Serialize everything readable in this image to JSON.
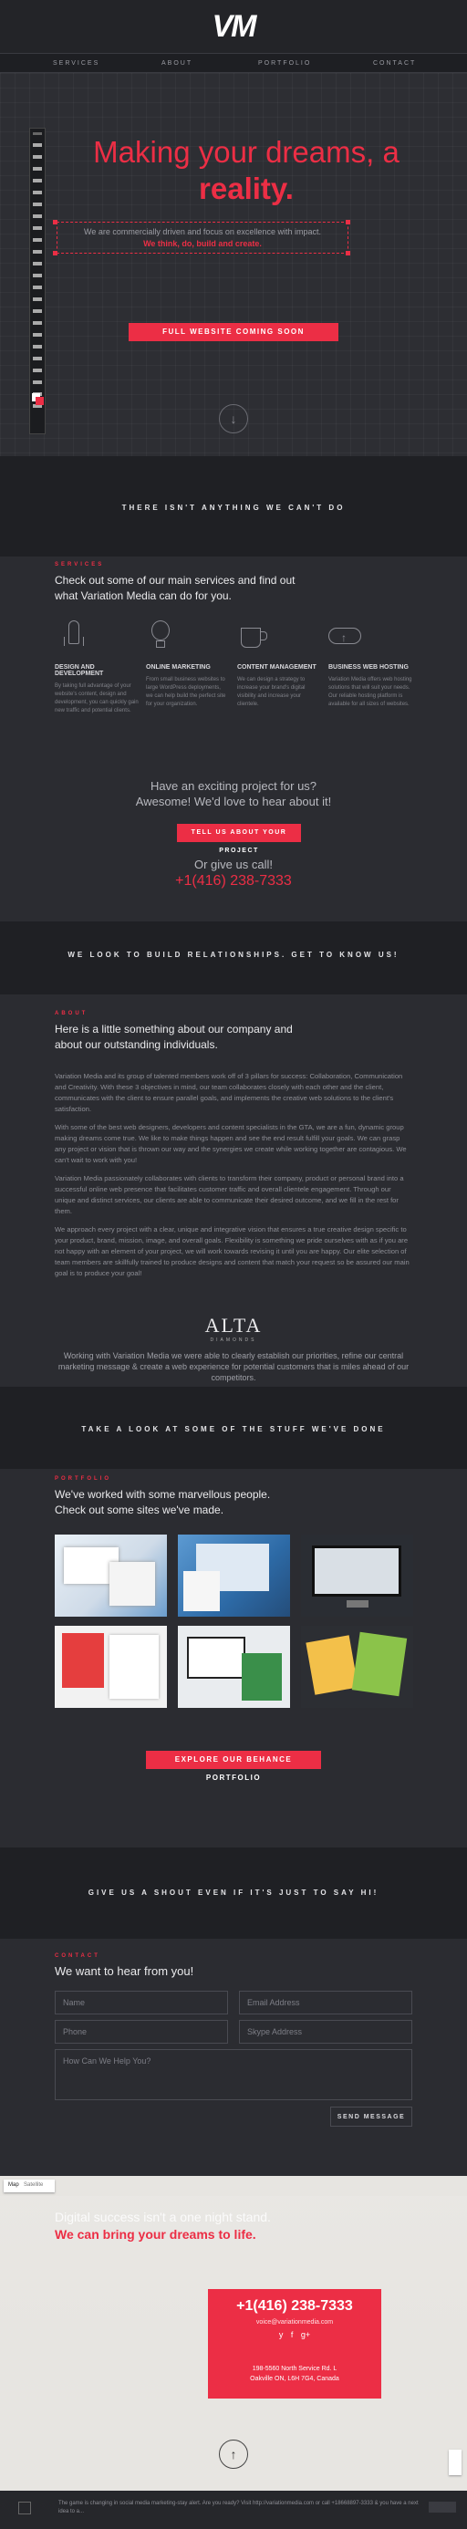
{
  "header": {
    "logo": "VM",
    "nav": [
      "SERVICES",
      "ABOUT",
      "PORTFOLIO",
      "CONTACT"
    ]
  },
  "hero": {
    "title_line1": "Making your dreams, a",
    "title_line2": "reality.",
    "subtitle": "We are commercially driven and focus on excellence with impact.",
    "tagline": "We think, do, build and create.",
    "cta": "FULL WEBSITE COMING SOON"
  },
  "band1": "THERE ISN'T ANYTHING WE CAN'T DO",
  "services": {
    "eyebrow": "SERVICES",
    "heading": "Check out some of our main services and find out what Variation Media can do for you.",
    "items": [
      {
        "icon": "rocket-icon",
        "title": "DESIGN AND DEVELOPMENT",
        "text": "By taking full advantage of your website's content, design and development, you can quickly gain new traffic and potential clients."
      },
      {
        "icon": "lightbulb-icon",
        "title": "ONLINE MARKETING",
        "text": "From small business websites to large WordPress deployments, we can help build the perfect site for your organization."
      },
      {
        "icon": "coffee-cup-icon",
        "title": "CONTENT MANAGEMENT",
        "text": "We can design a strategy to increase your brand's digital visibility and increase your clientele."
      },
      {
        "icon": "cloud-upload-icon",
        "title": "BUSINESS WEB HOSTING",
        "text": "Variation Media offers web hosting solutions that will suit your needs. Our reliable hosting platform is available for all sizes of websites."
      }
    ]
  },
  "project": {
    "line1": "Have an exciting project for us?",
    "line2": "Awesome! We'd love to hear about it!",
    "button": "TELL US ABOUT YOUR PROJECT",
    "or": "Or give us call!",
    "phone": "+1(416) 238-7333"
  },
  "band2": "WE LOOK TO BUILD RELATIONSHIPS. GET TO KNOW US!",
  "about": {
    "eyebrow": "ABOUT",
    "heading": "Here is a little something about our company and about our outstanding individuals.",
    "paragraphs": [
      "Variation Media and its group of talented members work off of 3 pillars for success: Collaboration, Communication and Creativity. With these 3 objectives in mind, our team collaborates closely with each other and the client, communicates with the client to ensure parallel goals, and implements the creative web solutions to the client's satisfaction.",
      "With some of the best web designers, developers and content specialists in the GTA, we are a fun, dynamic group making dreams come true. We like to make things happen and see the end result fulfill your goals. We can grasp any project or vision that is thrown our way and the synergies we create while working together are contagious. We can't wait to work with you!",
      "Variation Media passionately collaborates with clients to transform their company, product or personal brand into a successful online web presence that facilitates customer traffic and overall clientele engagement. Through our unique and distinct services, our clients are able to communicate their desired outcome, and we fill in the rest for them.",
      "We approach every project with a clear, unique and integrative vision that ensures a true creative design specific to your product, brand, mission, image, and overall goals. Flexibility is something we pride ourselves with as if you are not happy with an element of your project, we will work towards revising it until you are happy. Our elite selection of team members are skillfully trained to produce designs and content that match your request so be assured our main goal is to produce your goal!"
    ]
  },
  "testimonial": {
    "logo": "ALTA",
    "logo_sub": "DIAMONDS",
    "text": "Working with Variation Media we were able to clearly establish our priorities, refine our central marketing message & create a web experience for potential customers that is miles ahead of our competitors."
  },
  "band3": "TAKE A LOOK AT SOME OF THE STUFF WE'VE DONE",
  "portfolio": {
    "eyebrow": "PORTFOLIO",
    "heading": "We've worked with some marvellous people. Check out some sites we've made.",
    "button": "EXPLORE OUR BEHANCE PORTFOLIO"
  },
  "band4": "GIVE US A SHOUT EVEN IF IT'S JUST TO SAY HI!",
  "contact": {
    "eyebrow": "CONTACT",
    "heading": "We want to hear from you!",
    "name_ph": "Name",
    "email_ph": "Email Address",
    "phone_ph": "Phone",
    "skype_ph": "Skype Address",
    "message_ph": "How Can We Help You?",
    "send": "SEND MESSAGE"
  },
  "map": {
    "tabs": [
      "Map",
      "Satellite"
    ],
    "overlay1": "Digital success isn't a one night stand.",
    "overlay2": "We can bring your dreams to life.",
    "phone": "+1(416) 238-7333",
    "email": "voice@variationmedia.com",
    "social": [
      "y",
      "f",
      "g+"
    ],
    "address1": "198-5560 North Service Rd. L",
    "address2": "Oakville ON, L6H 7G4, Canada"
  },
  "footer": {
    "text": "The game is changing in social media marketing-stay alert. Are you ready? Visit http://variationmedia.com or call +18668897-3333 & you have a next idea to a..."
  },
  "colors": {
    "accent": "#ec2e45",
    "bg": "#2b2c31"
  }
}
